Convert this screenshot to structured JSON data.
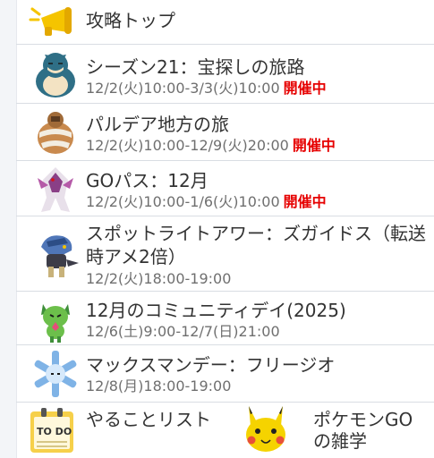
{
  "header": {
    "title": "攻略トップ",
    "icon": "megaphone-icon"
  },
  "events": [
    {
      "title": "シーズン21：宝探しの旅路",
      "period": "12/2(火)10:00-3/3(火)10:00",
      "status": "開催中",
      "icon": "snorlax-icon"
    },
    {
      "title": "パルデア地方の旅",
      "period": "12/2(火)10:00-12/9(火)20:00",
      "status": "開催中",
      "icon": "pokemon-icon"
    },
    {
      "title": "GOパス：12月",
      "period": "12/2(火)10:00-1/6(火)10:00",
      "status": "開催中",
      "icon": "pokemon-icon"
    },
    {
      "title": "スポットライトアワー：ズガイドス（転送時アメ2倍）",
      "period": "12/2(火)18:00-19:00",
      "status": "",
      "icon": "cranidos-icon"
    },
    {
      "title": "12月のコミュニティデイ(2025)",
      "period": "12/6(土)9:00-12/7(日)21:00",
      "status": "",
      "icon": "sprigatito-icon"
    },
    {
      "title": "マックスマンデー：フリージオ",
      "period": "12/8(月)18:00-19:00",
      "status": "",
      "icon": "cryogonal-icon"
    }
  ],
  "bottom": [
    {
      "label": "やることリスト",
      "icon": "todo-list-icon"
    },
    {
      "label": "ポケモンGOの雑学",
      "icon": "pikachu-icon"
    }
  ],
  "colors": {
    "status": "#e60000",
    "divider": "#d9dde3",
    "accent": "#f5c400"
  }
}
